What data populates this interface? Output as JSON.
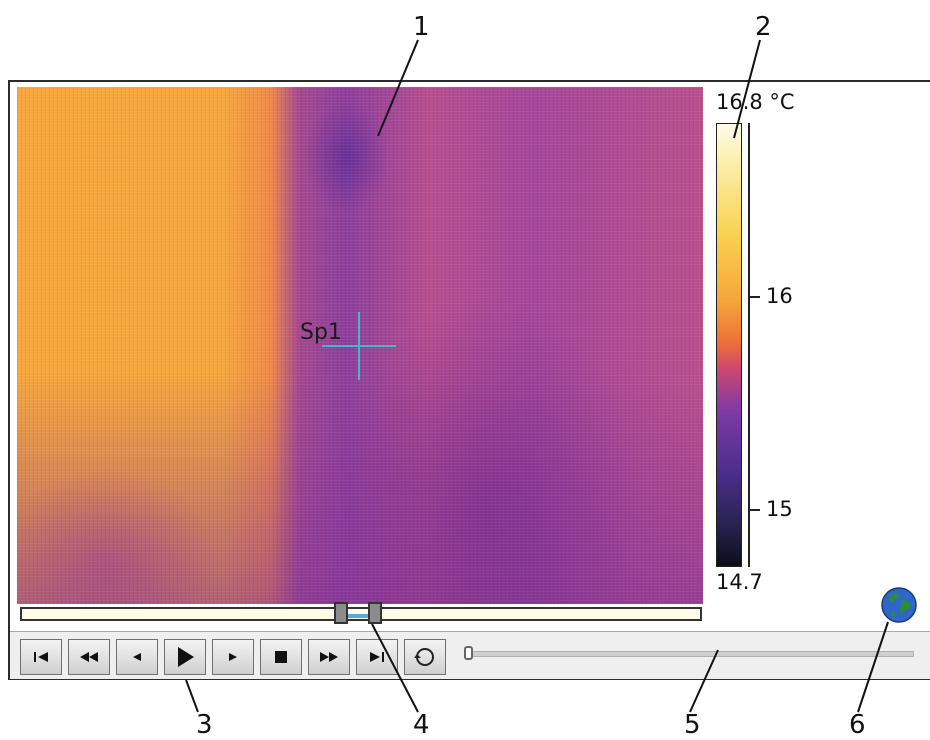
{
  "callouts": [
    "1",
    "2",
    "3",
    "4",
    "5",
    "6"
  ],
  "thermal_image": {
    "spot": {
      "label": "Sp1",
      "icon": "crosshair-icon"
    }
  },
  "scale": {
    "max_label": "16.8 °C",
    "min_label": "14.7",
    "ticks": [
      "16",
      "15"
    ],
    "palette": "iron",
    "colors": [
      "#fffce8",
      "#f9d24f",
      "#f6a63b",
      "#d0486c",
      "#7d3aa5",
      "#2a2455",
      "#0b0d18"
    ]
  },
  "timeline": {
    "range_start_fraction": 0.47,
    "range_end_fraction": 0.52
  },
  "controls": [
    {
      "id": "first",
      "icon": "skip-to-start-icon"
    },
    {
      "id": "rewind",
      "icon": "fast-rewind-icon"
    },
    {
      "id": "step-back",
      "icon": "step-back-icon"
    },
    {
      "id": "play",
      "icon": "play-icon"
    },
    {
      "id": "step-forward",
      "icon": "step-forward-icon"
    },
    {
      "id": "stop",
      "icon": "stop-icon"
    },
    {
      "id": "fast-forward",
      "icon": "fast-forward-icon"
    },
    {
      "id": "last",
      "icon": "skip-to-end-icon"
    },
    {
      "id": "loop",
      "icon": "loop-icon"
    }
  ],
  "speed_slider": {
    "value_fraction": 0.0
  },
  "status": {
    "icon": "globe-icon",
    "colors": [
      "#2f67c9",
      "#2e8b3a"
    ]
  }
}
